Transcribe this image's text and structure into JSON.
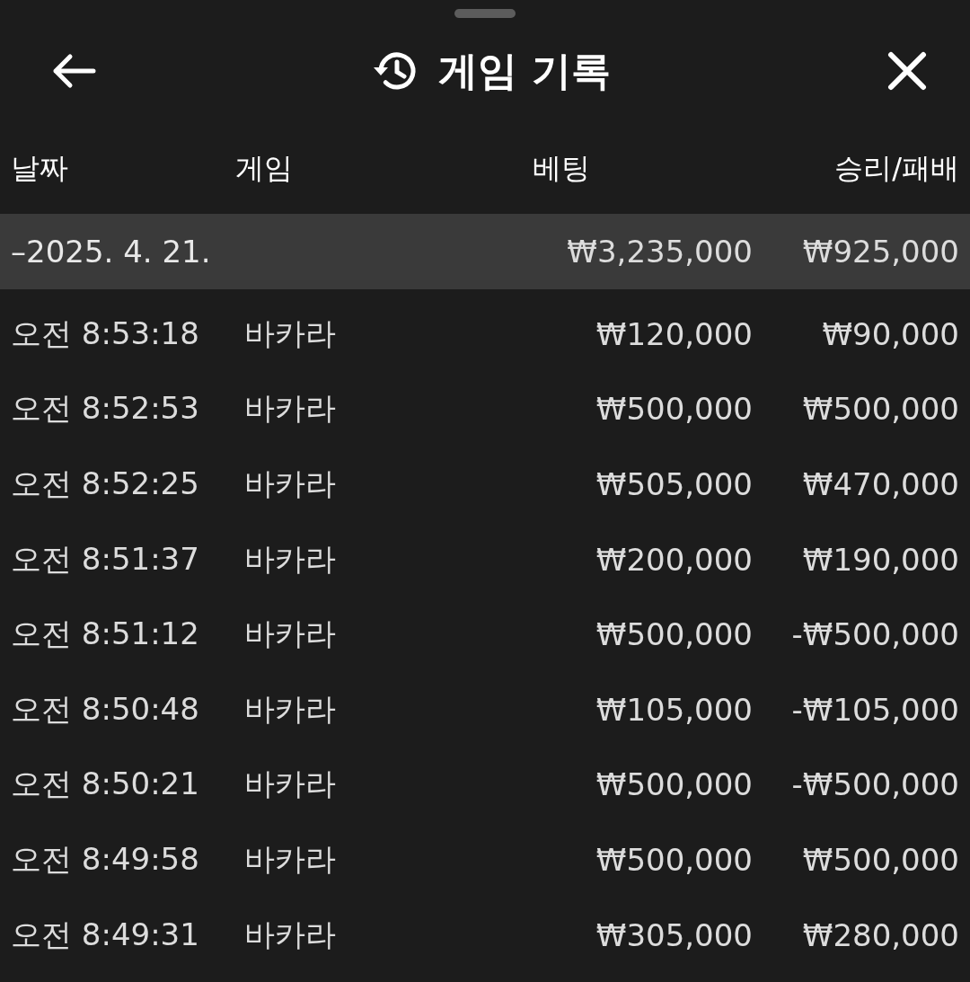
{
  "header": {
    "title": "게임 기록"
  },
  "columns": [
    "날짜",
    "게임",
    "베팅",
    "승리/패배"
  ],
  "group": {
    "toggle": "–",
    "date": "2025. 4. 21.",
    "bet_total": "₩3,235,000",
    "result_total": "₩925,000"
  },
  "rows": [
    {
      "time": "오전 8:53:18",
      "game": "바카라",
      "bet": "₩120,000",
      "result": "₩90,000"
    },
    {
      "time": "오전 8:52:53",
      "game": "바카라",
      "bet": "₩500,000",
      "result": "₩500,000"
    },
    {
      "time": "오전 8:52:25",
      "game": "바카라",
      "bet": "₩505,000",
      "result": "₩470,000"
    },
    {
      "time": "오전 8:51:37",
      "game": "바카라",
      "bet": "₩200,000",
      "result": "₩190,000"
    },
    {
      "time": "오전 8:51:12",
      "game": "바카라",
      "bet": "₩500,000",
      "result": "-₩500,000"
    },
    {
      "time": "오전 8:50:48",
      "game": "바카라",
      "bet": "₩105,000",
      "result": "-₩105,000"
    },
    {
      "time": "오전 8:50:21",
      "game": "바카라",
      "bet": "₩500,000",
      "result": "-₩500,000"
    },
    {
      "time": "오전 8:49:58",
      "game": "바카라",
      "bet": "₩500,000",
      "result": "₩500,000"
    },
    {
      "time": "오전 8:49:31",
      "game": "바카라",
      "bet": "₩305,000",
      "result": "₩280,000"
    }
  ]
}
